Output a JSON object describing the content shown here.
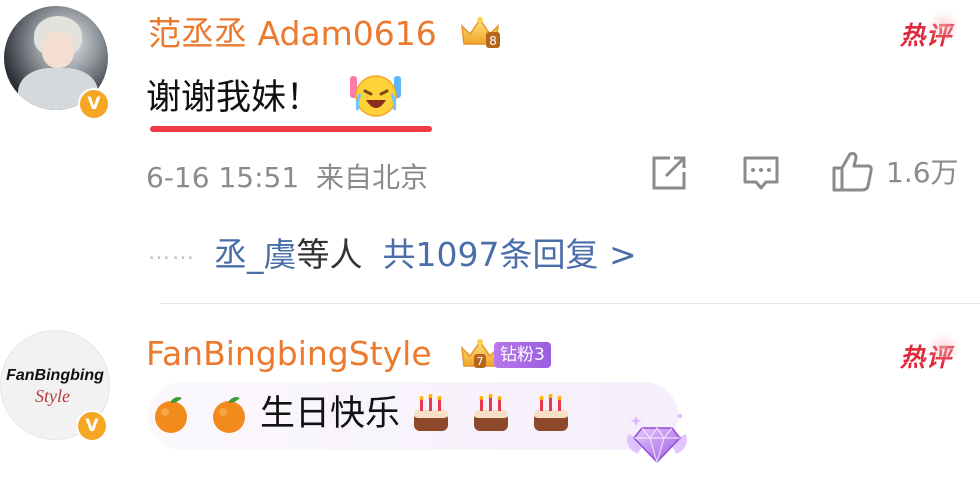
{
  "comments": [
    {
      "username": "范丞丞 Adam0616",
      "crown_level": "8",
      "hot_label": "热评",
      "text": "谢谢我妹！",
      "emoji": "laughing-crying-face",
      "timestamp": "6-16 15:51",
      "source": "来自北京",
      "like_count": "1.6万",
      "replies": {
        "dots": "……",
        "name": "丞_虞",
        "suffix": "等人",
        "summary": "共1097条回复 >"
      }
    },
    {
      "username": "FanBingbingStyle",
      "crown_level": "7",
      "fan_badge": "钻粉3",
      "hot_label": "热评",
      "avatar_text_1": "FanBingbing",
      "avatar_text_2": "Style",
      "text": "生日快乐",
      "emojis_before": [
        "tangerine",
        "tangerine"
      ],
      "emojis_after": [
        "cake",
        "cake",
        "cake"
      ]
    }
  ],
  "colors": {
    "username": "#eb7a2f",
    "hot": "#e0293b",
    "link": "#4a6ea8",
    "meta": "#8b8b8b",
    "verified": "#f5a623",
    "fan_badge": "#a866e5"
  },
  "icons": {
    "share": "share-icon",
    "comment": "comment-icon",
    "like": "thumbs-up-icon",
    "verified": "verified-v-icon"
  }
}
